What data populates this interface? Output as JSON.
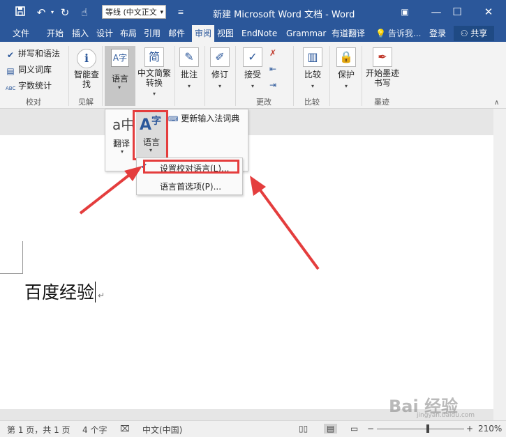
{
  "titlebar": {
    "font_box": "等线 (中文正文",
    "title": "新建 Microsoft Word 文档 - Word",
    "icons": [
      "save-icon",
      "undo-icon",
      "redo-icon",
      "touch-mode-icon",
      "customize-qat-icon"
    ],
    "window_buttons": [
      "minimize-icon",
      "maximize-icon",
      "close-icon",
      "ribbon-display-icon"
    ]
  },
  "tabs": [
    {
      "label": "文件"
    },
    {
      "label": "开始"
    },
    {
      "label": "插入"
    },
    {
      "label": "设计"
    },
    {
      "label": "布局"
    },
    {
      "label": "引用"
    },
    {
      "label": "邮件"
    },
    {
      "label": "审阅",
      "active": true
    },
    {
      "label": "视图"
    },
    {
      "label": "EndNote"
    },
    {
      "label": "Grammar"
    },
    {
      "label": "有道翻译"
    }
  ],
  "tellme": "告诉我...",
  "login": "登录",
  "share": "共享",
  "ribbon": {
    "proofing": {
      "items": [
        "拼写和语法",
        "同义词库",
        "字数统计"
      ],
      "label": "校对"
    },
    "insights": {
      "smart_lookup": "智能查找",
      "label": "见解"
    },
    "language": {
      "label": "语言"
    },
    "chinese_conversion": {
      "label": "中文简繁转换"
    },
    "comments": {
      "label": "批注"
    },
    "tracking": {
      "label": "修订"
    },
    "changes": {
      "accept": "接受",
      "label": "更改"
    },
    "compare": {
      "label": "比较",
      "group": "比较"
    },
    "protect": {
      "label": "保护"
    },
    "ink": {
      "label": "开始墨迹书写",
      "group": "墨迹"
    }
  },
  "lang_panel": {
    "translate": "翻译",
    "language": "语言",
    "update_ime": "更新输入法词典"
  },
  "lang_menu": {
    "set_proofing": "设置校对语言(L)...",
    "preferences": "语言首选项(P)..."
  },
  "document": {
    "text": "百度经验"
  },
  "status": {
    "page": "第 1 页，共 1 页",
    "words": "4 个字",
    "language": "中文(中国)",
    "zoom": "210%",
    "zoom_fraction": 0.58
  },
  "watermark": {
    "text": "Bai 经验",
    "sub": "jingyan.baidu.com"
  },
  "colors": {
    "accent": "#2b579a",
    "highlight": "#e43d3d"
  }
}
